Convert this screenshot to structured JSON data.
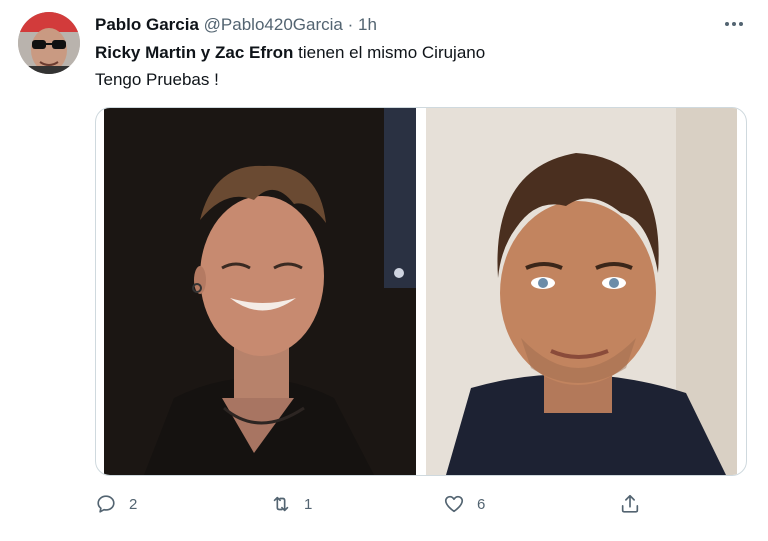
{
  "tweet": {
    "author_name": "Pablo Garcia",
    "handle": "@Pablo420Garcia",
    "separator": "·",
    "time": "1h",
    "text_bold": "Ricky Martin y Zac Efron",
    "text_rest": " tienen el mismo Cirujano",
    "text_line2": "Tengo Pruebas !"
  },
  "actions": {
    "replies": "2",
    "retweets": "1",
    "likes": "6"
  },
  "colors": {
    "text": "#0f1419",
    "secondary": "#536471",
    "border": "#cfd9de"
  },
  "icons": [
    "more-icon",
    "reply-icon",
    "retweet-icon",
    "like-icon",
    "share-icon"
  ]
}
